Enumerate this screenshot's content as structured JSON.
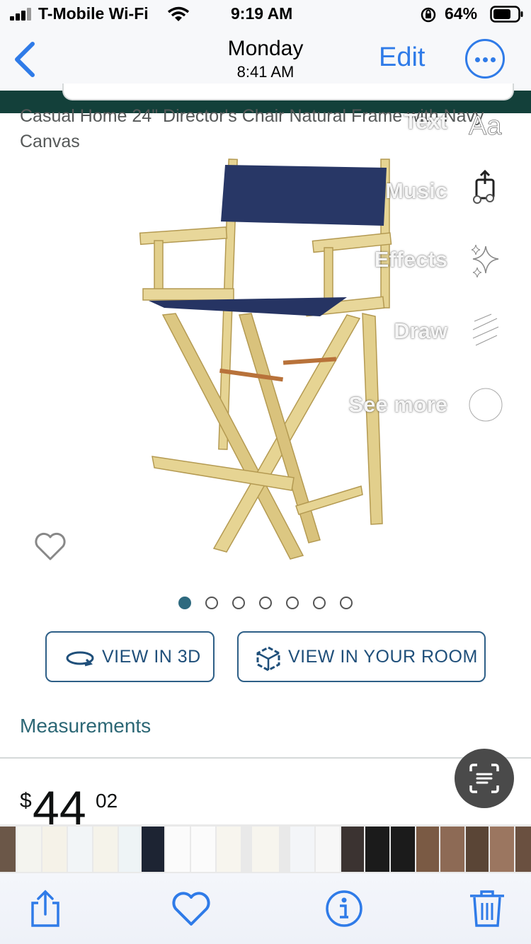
{
  "status": {
    "carrier": "T-Mobile Wi-Fi",
    "time": "9:19 AM",
    "battery": "64%"
  },
  "nav": {
    "day": "Monday",
    "time": "8:41 AM",
    "edit": "Edit"
  },
  "product": {
    "title": "Casual Home 24\" Director's Chair Natural Frame with Navy Canvas",
    "image_count": 7,
    "active_image": 1
  },
  "overlay_menu": [
    {
      "label": "Text",
      "icon": "text-aa-icon"
    },
    {
      "label": "Music",
      "icon": "music-icon"
    },
    {
      "label": "Effects",
      "icon": "sparkles-icon"
    },
    {
      "label": "Draw",
      "icon": "scribble-icon"
    },
    {
      "label": "See more",
      "icon": "chevron-circle-icon"
    }
  ],
  "buttons": {
    "view3d": "VIEW IN 3D",
    "room": "VIEW IN YOUR ROOM"
  },
  "measurements": "Measurements",
  "price": {
    "symbol": "$",
    "whole": "44",
    "fraction": "02"
  },
  "colors": {
    "ios_blue": "#2f7be8",
    "amazon_teal": "#2c6775",
    "header_green": "#13403a",
    "chair_canvas": "#283766",
    "chair_wood": "#e2cf8c"
  }
}
